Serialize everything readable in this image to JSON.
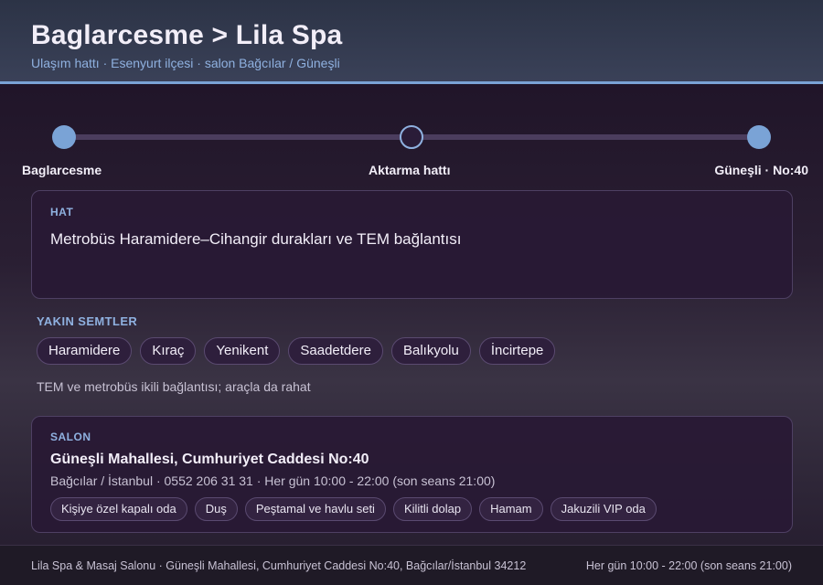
{
  "header": {
    "title": "Baglarcesme > Lila Spa",
    "subtitle": "Ulaşım hattı · Esenyurt ilçesi · salon Bağcılar / Güneşli"
  },
  "route": {
    "stops": [
      {
        "label": "Baglarcesme"
      },
      {
        "label": "Aktarma hattı"
      },
      {
        "label": "Güneşli · No:40"
      }
    ]
  },
  "line_card": {
    "label": "HAT",
    "text": "Metrobüs Haramidere–Cihangir durakları ve TEM bağlantısı"
  },
  "nearby": {
    "label": "YAKIN SEMTLER",
    "items": [
      "Haramidere",
      "Kıraç",
      "Yenikent",
      "Saadetdere",
      "Balıkyolu",
      "İncirtepe"
    ],
    "note": "TEM ve metrobüs ikili bağlantısı; araçla da rahat"
  },
  "salon": {
    "label": "SALON",
    "address": "Güneşli Mahallesi, Cumhuriyet Caddesi No:40",
    "meta": "Bağcılar / İstanbul · 0552 206 31 31 · Her gün 10:00 - 22:00 (son seans 21:00)",
    "amenities": [
      "Kişiye özel kapalı oda",
      "Duş",
      "Peştamal ve havlu seti",
      "Kilitli dolap",
      "Hamam",
      "Jakuzili VIP oda"
    ]
  },
  "footer": {
    "left": "Lila Spa & Masaj Salonu · Güneşli Mahallesi, Cumhuriyet Caddesi No:40, Bağcılar/İstanbul 34212",
    "right": "Her gün 10:00 - 22:00 (son seans 21:00)"
  },
  "colors": {
    "accent": "#7aa3d6",
    "header_bg": "#343b51",
    "card_bg": "#28193a"
  }
}
